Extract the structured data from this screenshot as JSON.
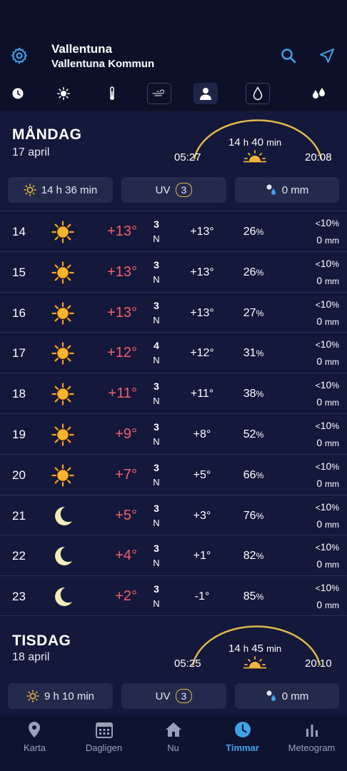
{
  "header": {
    "location_title": "Vallentuna",
    "location_subtitle": "Vallentuna Kommun"
  },
  "toolbar": {
    "items": [
      "clock-icon",
      "sun-icon",
      "thermometer-icon",
      "wind-icon",
      "person-icon",
      "drop-icon",
      "drops-icon"
    ],
    "active": "person-icon"
  },
  "days": [
    {
      "name": "MÅNDAG",
      "date": "17 april",
      "sunrise": "05:27",
      "sunset": "20:08",
      "daylight_hours": "14",
      "daylight_h_unit": "h",
      "daylight_minutes": "40",
      "daylight_min_unit": "min",
      "sunshine": "14 h 36 min",
      "uv_label": "UV",
      "uv_value": "3",
      "precip": "0 mm"
    },
    {
      "name": "TISDAG",
      "date": "18 april",
      "sunrise": "05:25",
      "sunset": "20:10",
      "daylight_hours": "14",
      "daylight_h_unit": "h",
      "daylight_minutes": "45",
      "daylight_min_unit": "min",
      "sunshine": "9 h 10 min",
      "uv_label": "UV",
      "uv_value": "3",
      "precip": "0 mm"
    }
  ],
  "hourly": [
    {
      "hour": "14",
      "icon": "sun-icon",
      "temp": "+13°",
      "wind_speed": "3",
      "wind_dir": "N",
      "feels": "+13°",
      "humidity": "26",
      "hum_unit": "%",
      "prob_prefix": "<",
      "prob": "10",
      "prob_unit": "%",
      "precip": "0",
      "precip_unit": "mm"
    },
    {
      "hour": "15",
      "icon": "sun-icon",
      "temp": "+13°",
      "wind_speed": "3",
      "wind_dir": "N",
      "feels": "+13°",
      "humidity": "26",
      "hum_unit": "%",
      "prob_prefix": "<",
      "prob": "10",
      "prob_unit": "%",
      "precip": "0",
      "precip_unit": "mm"
    },
    {
      "hour": "16",
      "icon": "sun-icon",
      "temp": "+13°",
      "wind_speed": "3",
      "wind_dir": "N",
      "feels": "+13°",
      "humidity": "27",
      "hum_unit": "%",
      "prob_prefix": "<",
      "prob": "10",
      "prob_unit": "%",
      "precip": "0",
      "precip_unit": "mm"
    },
    {
      "hour": "17",
      "icon": "sun-icon",
      "temp": "+12°",
      "wind_speed": "4",
      "wind_dir": "N",
      "feels": "+12°",
      "humidity": "31",
      "hum_unit": "%",
      "prob_prefix": "<",
      "prob": "10",
      "prob_unit": "%",
      "precip": "0",
      "precip_unit": "mm"
    },
    {
      "hour": "18",
      "icon": "sun-icon",
      "temp": "+11°",
      "wind_speed": "3",
      "wind_dir": "N",
      "feels": "+11°",
      "humidity": "38",
      "hum_unit": "%",
      "prob_prefix": "<",
      "prob": "10",
      "prob_unit": "%",
      "precip": "0",
      "precip_unit": "mm"
    },
    {
      "hour": "19",
      "icon": "sun-icon",
      "temp": "+9°",
      "wind_speed": "3",
      "wind_dir": "N",
      "feels": "+8°",
      "humidity": "52",
      "hum_unit": "%",
      "prob_prefix": "<",
      "prob": "10",
      "prob_unit": "%",
      "precip": "0",
      "precip_unit": "mm"
    },
    {
      "hour": "20",
      "icon": "sun-icon",
      "temp": "+7°",
      "wind_speed": "3",
      "wind_dir": "N",
      "feels": "+5°",
      "humidity": "66",
      "hum_unit": "%",
      "prob_prefix": "<",
      "prob": "10",
      "prob_unit": "%",
      "precip": "0",
      "precip_unit": "mm"
    },
    {
      "hour": "21",
      "icon": "moon-icon",
      "temp": "+5°",
      "wind_speed": "3",
      "wind_dir": "N",
      "feels": "+3°",
      "humidity": "76",
      "hum_unit": "%",
      "prob_prefix": "<",
      "prob": "10",
      "prob_unit": "%",
      "precip": "0",
      "precip_unit": "mm"
    },
    {
      "hour": "22",
      "icon": "moon-icon",
      "temp": "+4°",
      "wind_speed": "3",
      "wind_dir": "N",
      "feels": "+1°",
      "humidity": "82",
      "hum_unit": "%",
      "prob_prefix": "<",
      "prob": "10",
      "prob_unit": "%",
      "precip": "0",
      "precip_unit": "mm"
    },
    {
      "hour": "23",
      "icon": "moon-icon",
      "temp": "+2°",
      "wind_speed": "3",
      "wind_dir": "N",
      "feels": "-1°",
      "humidity": "85",
      "hum_unit": "%",
      "prob_prefix": "<",
      "prob": "10",
      "prob_unit": "%",
      "precip": "0",
      "precip_unit": "mm"
    }
  ],
  "nav": [
    {
      "label": "Karta",
      "icon": "map-pin-icon"
    },
    {
      "label": "Dagligen",
      "icon": "calendar-icon"
    },
    {
      "label": "Nu",
      "icon": "home-icon"
    },
    {
      "label": "Timmar",
      "icon": "clock-icon"
    },
    {
      "label": "Meteogram",
      "icon": "bar-chart-icon"
    }
  ],
  "nav_active": "Timmar",
  "colors": {
    "background": "#14183a",
    "header": "#0c1129",
    "accent": "#3fa3ea",
    "temperature": "#f0606a",
    "sun_arc": "#e0b84a"
  }
}
